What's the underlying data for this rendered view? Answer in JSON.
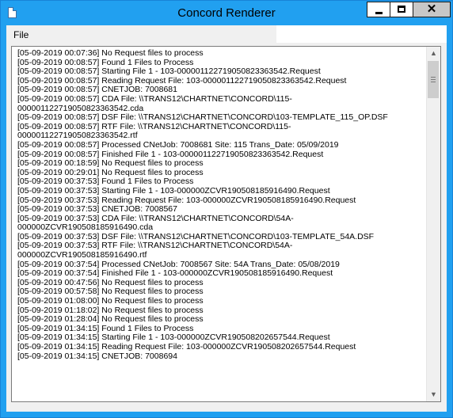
{
  "window": {
    "title": "Concord Renderer",
    "controls": {
      "minimize": "minimize",
      "maximize": "maximize",
      "close": "✕"
    }
  },
  "menu": {
    "file": "File"
  },
  "log": {
    "lines": [
      "[05-09-2019 00:07:36] No Request files to process",
      "[05-09-2019 00:08:57]  Found 1 Files to Process",
      "[05-09-2019 00:08:57]  Starting File 1 - 103-000001122719050823363542.Request",
      "[05-09-2019 00:08:57]   Reading Request File: 103-000001122719050823363542.Request",
      "[05-09-2019 00:08:57]   CNETJOB: 7008681",
      "[05-09-2019 00:08:57]      CDA File: \\\\TRANS12\\CHARTNET\\CONCORD\\115-",
      "000001122719050823363542.cda",
      "[05-09-2019 00:08:57]      DSF File: \\\\TRANS12\\CHARTNET\\CONCORD\\103-TEMPLATE_115_OP.DSF",
      "[05-09-2019 00:08:57]      RTF File: \\\\TRANS12\\CHARTNET\\CONCORD\\115-",
      "000001122719050823363542.rtf",
      "[05-09-2019 00:08:57]  Processed  CNetJob: 7008681  Site: 115  Trans_Date: 05/09/2019",
      "[05-09-2019 00:08:57]  Finished File 1 - 103-000001122719050823363542.Request",
      "[05-09-2019 00:18:59] No Request files to process",
      "[05-09-2019 00:29:01] No Request files to process",
      "[05-09-2019 00:37:53]  Found 1 Files to Process",
      "[05-09-2019 00:37:53]  Starting File 1 - 103-000000ZCVR190508185916490.Request",
      "[05-09-2019 00:37:53]   Reading Request File: 103-000000ZCVR190508185916490.Request",
      "[05-09-2019 00:37:53]   CNETJOB: 7008567",
      "[05-09-2019 00:37:53]      CDA File: \\\\TRANS12\\CHARTNET\\CONCORD\\54A-",
      "000000ZCVR190508185916490.cda",
      "[05-09-2019 00:37:53]      DSF File: \\\\TRANS12\\CHARTNET\\CONCORD\\103-TEMPLATE_54A.DSF",
      "[05-09-2019 00:37:53]      RTF File: \\\\TRANS12\\CHARTNET\\CONCORD\\54A-",
      "000000ZCVR190508185916490.rtf",
      "[05-09-2019 00:37:54]  Processed  CNetJob: 7008567  Site: 54A  Trans_Date: 05/08/2019",
      "[05-09-2019 00:37:54]  Finished File 1 - 103-000000ZCVR190508185916490.Request",
      "[05-09-2019 00:47:56] No Request files to process",
      "[05-09-2019 00:57:58] No Request files to process",
      "[05-09-2019 01:08:00] No Request files to process",
      "[05-09-2019 01:18:02] No Request files to process",
      "[05-09-2019 01:28:04] No Request files to process",
      "[05-09-2019 01:34:15]  Found 1 Files to Process",
      "[05-09-2019 01:34:15]  Starting File 1 - 103-000000ZCVR190508202657544.Request",
      "[05-09-2019 01:34:15]   Reading Request File: 103-000000ZCVR190508202657544.Request",
      "[05-09-2019 01:34:15]   CNETJOB: 7008694"
    ]
  },
  "scrollbar": {
    "up_icon": "▲",
    "down_icon": "▼"
  }
}
